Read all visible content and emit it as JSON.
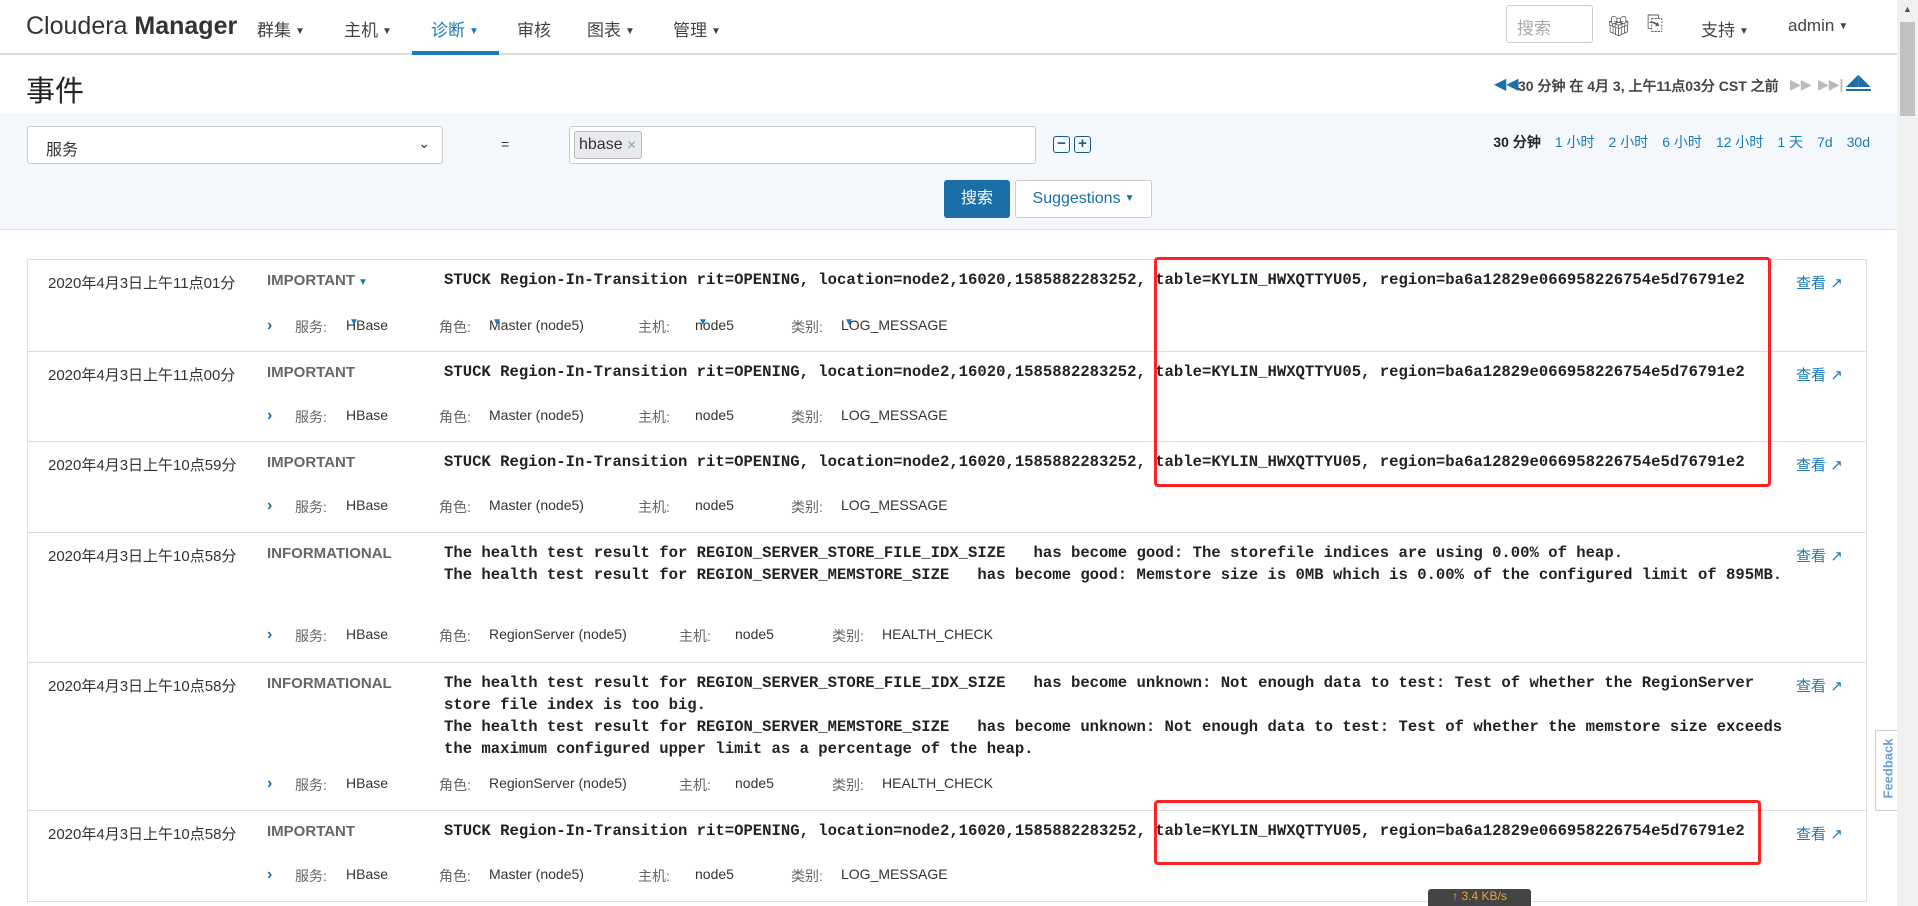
{
  "nav": {
    "brand_light": "Cloudera",
    "brand_bold": "Manager",
    "items": [
      {
        "label": "群集",
        "caret": true
      },
      {
        "label": "主机",
        "caret": true
      },
      {
        "label": "诊断",
        "caret": true,
        "active": true
      },
      {
        "label": "审核",
        "caret": false
      },
      {
        "label": "图表",
        "caret": true
      },
      {
        "label": "管理",
        "caret": true
      }
    ],
    "search_placeholder": "搜索",
    "support": "支持",
    "user": "admin",
    "accent": "#1a7bb9"
  },
  "page": {
    "title": "事件",
    "time_window": "30 分钟 在 4月 3, 上午11点03分 CST 之前"
  },
  "filter": {
    "field": "服务",
    "operator": "=",
    "tokens": [
      "hbase"
    ],
    "search_button": "搜索",
    "suggestions_button": "Suggestions",
    "ranges": [
      {
        "label": "30 分钟",
        "current": true
      },
      {
        "label": "1 小时"
      },
      {
        "label": "2 小时"
      },
      {
        "label": "6 小时"
      },
      {
        "label": "12 小时"
      },
      {
        "label": "1 天"
      },
      {
        "label": "7d"
      },
      {
        "label": "30d"
      }
    ]
  },
  "labels": {
    "service": "服务:",
    "role": "角色:",
    "host": "主机:",
    "category": "类别:",
    "view": "查看"
  },
  "events": [
    {
      "time": "2020年4月3日上午11点01分",
      "severity": "IMPORTANT",
      "message": "STUCK Region-In-Transition rit=OPENING, location=node2,16020,1585882283252, table=KYLIN_HWXQTTYU05, region=ba6a12829e066958226754e5d76791e2",
      "service": "HBase",
      "role": "Master (node5)",
      "host": "node5",
      "category": "LOG_MESSAGE",
      "filters": true
    },
    {
      "time": "2020年4月3日上午11点00分",
      "severity": "IMPORTANT",
      "message": "STUCK Region-In-Transition rit=OPENING, location=node2,16020,1585882283252, table=KYLIN_HWXQTTYU05, region=ba6a12829e066958226754e5d76791e2",
      "service": "HBase",
      "role": "Master (node5)",
      "host": "node5",
      "category": "LOG_MESSAGE"
    },
    {
      "time": "2020年4月3日上午10点59分",
      "severity": "IMPORTANT",
      "message": "STUCK Region-In-Transition rit=OPENING, location=node2,16020,1585882283252, table=KYLIN_HWXQTTYU05, region=ba6a12829e066958226754e5d76791e2",
      "service": "HBase",
      "role": "Master (node5)",
      "host": "node5",
      "category": "LOG_MESSAGE"
    },
    {
      "time": "2020年4月3日上午10点58分",
      "severity": "INFORMATIONAL",
      "message": "The health test result for REGION_SERVER_STORE_FILE_IDX_SIZE   has become good: The storefile indices are using 0.00% of heap.\nThe health test result for REGION_SERVER_MEMSTORE_SIZE   has become good: Memstore size is 0MB which is 0.00% of the configured limit of 895MB.",
      "service": "HBase",
      "role": "RegionServer (node5)",
      "host": "node5",
      "category": "HEALTH_CHECK"
    },
    {
      "time": "2020年4月3日上午10点58分",
      "severity": "INFORMATIONAL",
      "message": "The health test result for REGION_SERVER_STORE_FILE_IDX_SIZE   has become unknown: Not enough data to test: Test of whether the RegionServer store file index is too big.\nThe health test result for REGION_SERVER_MEMSTORE_SIZE   has become unknown: Not enough data to test: Test of whether the memstore size exceeds the maximum configured upper limit as a percentage of the heap.",
      "service": "HBase",
      "role": "RegionServer (node5)",
      "host": "node5",
      "category": "HEALTH_CHECK"
    },
    {
      "time": "2020年4月3日上午10点58分",
      "severity": "IMPORTANT",
      "message": "STUCK Region-In-Transition rit=OPENING, location=node2,16020,1585882283252, table=KYLIN_HWXQTTYU05, region=ba6a12829e066958226754e5d76791e2",
      "service": "HBase",
      "role": "Master (node5)",
      "host": "node5",
      "category": "LOG_MESSAGE"
    }
  ],
  "feedback": "Feedback",
  "network_tip": "↑ 3.4 KB/s",
  "highlight_color": "#ff2222"
}
